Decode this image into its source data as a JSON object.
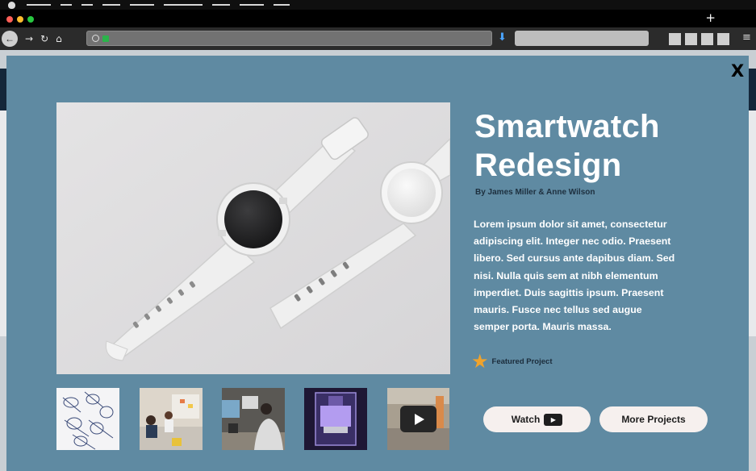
{
  "browser": {
    "menu_dashes": 11,
    "new_tab_label": "+",
    "nav": {
      "back": "←",
      "forward": "→",
      "reload": "↻",
      "home": "⌂"
    },
    "download_icon": "⬇",
    "menu_icon": "≡"
  },
  "modal": {
    "close_label": "X",
    "title": "Smartwatch Redesign",
    "byline": "By James Miller & Anne Wilson",
    "description": "Lorem ipsum dolor sit amet, consectetur adipiscing elit. Integer nec odio. Praesent libero. Sed cursus ante dapibus diam. Sed nisi. Nulla quis sem at nibh elementum imperdiet. Duis sagittis ipsum. Praesent mauris. Fusce nec tellus sed augue semper porta. Mauris massa.",
    "featured_label": "Featured Project",
    "watch_label": "Watch",
    "more_label": "More Projects",
    "thumbnails": [
      "sketches",
      "team-meeting",
      "designers-at-desk",
      "lab-machine",
      "video-thumbnail"
    ]
  },
  "colors": {
    "modal_bg": "#5f8aa2",
    "star": "#f0a32c",
    "button_bg": "#f6f0ee"
  }
}
